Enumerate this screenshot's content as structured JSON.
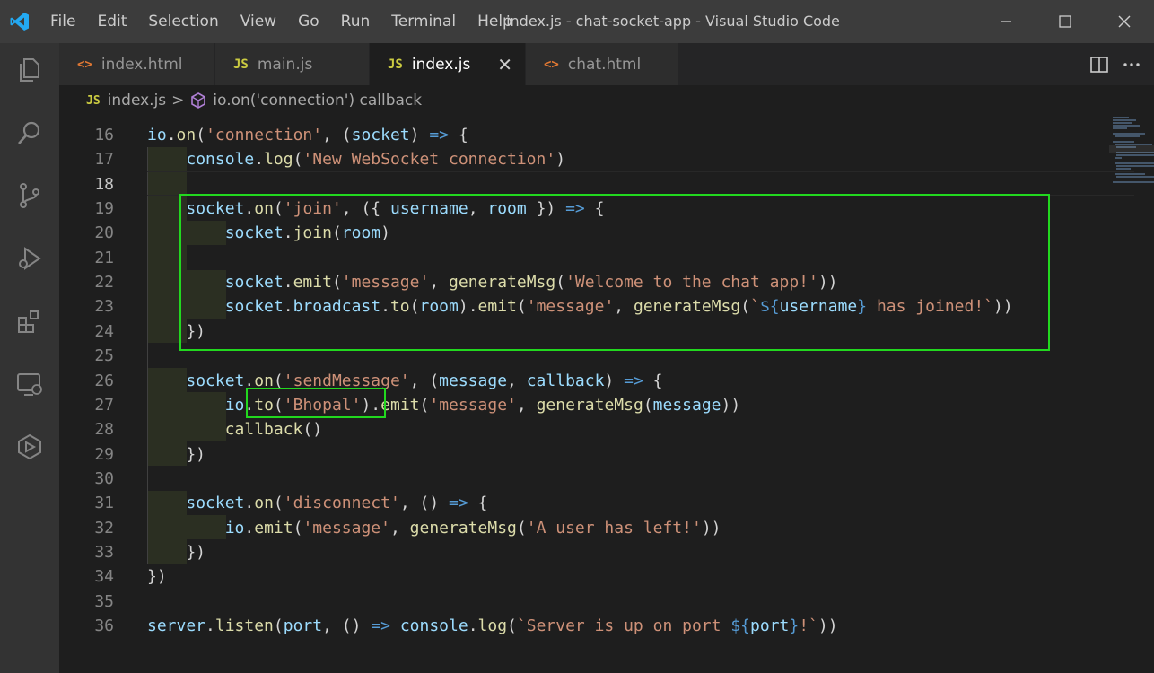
{
  "menu": [
    "File",
    "Edit",
    "Selection",
    "View",
    "Go",
    "Run",
    "Terminal",
    "Help"
  ],
  "window_title": "index.js - chat-socket-app - Visual Studio Code",
  "tabs": [
    {
      "label": "index.html",
      "icon": "<>",
      "type": "html",
      "active": false
    },
    {
      "label": "main.js",
      "icon": "JS",
      "type": "js",
      "active": false
    },
    {
      "label": "index.js",
      "icon": "JS",
      "type": "js",
      "active": true
    },
    {
      "label": "chat.html",
      "icon": "<>",
      "type": "html",
      "active": false
    }
  ],
  "tab_close": "✕",
  "breadcrumb": {
    "file_icon": "JS",
    "file": "index.js",
    "separator": ">",
    "symbol": "io.on('connection') callback"
  },
  "line_numbers": [
    "16",
    "17",
    "18",
    "19",
    "20",
    "21",
    "22",
    "23",
    "24",
    "25",
    "26",
    "27",
    "28",
    "29",
    "30",
    "31",
    "32",
    "33",
    "34",
    "35",
    "36"
  ],
  "current_line": "18",
  "code_lines": [
    [
      [
        "var",
        "io"
      ],
      [
        "pun",
        "."
      ],
      [
        "fn",
        "on"
      ],
      [
        "pun",
        "("
      ],
      [
        "str",
        "'connection'"
      ],
      [
        "pun",
        ", ("
      ],
      [
        "var",
        "socket"
      ],
      [
        "pun",
        ") "
      ],
      [
        "kw",
        "=>"
      ],
      [
        "pun",
        " {"
      ]
    ],
    [
      [
        "pun",
        "    "
      ],
      [
        "var",
        "console"
      ],
      [
        "pun",
        "."
      ],
      [
        "fn",
        "log"
      ],
      [
        "pun",
        "("
      ],
      [
        "str",
        "'New WebSocket connection'"
      ],
      [
        "pun",
        ")"
      ]
    ],
    [],
    [
      [
        "pun",
        "    "
      ],
      [
        "var",
        "socket"
      ],
      [
        "pun",
        "."
      ],
      [
        "fn",
        "on"
      ],
      [
        "pun",
        "("
      ],
      [
        "str",
        "'join'"
      ],
      [
        "pun",
        ", ({ "
      ],
      [
        "var",
        "username"
      ],
      [
        "pun",
        ", "
      ],
      [
        "var",
        "room"
      ],
      [
        "pun",
        " }) "
      ],
      [
        "kw",
        "=>"
      ],
      [
        "pun",
        " {"
      ]
    ],
    [
      [
        "pun",
        "        "
      ],
      [
        "var",
        "socket"
      ],
      [
        "pun",
        "."
      ],
      [
        "fn",
        "join"
      ],
      [
        "pun",
        "("
      ],
      [
        "var",
        "room"
      ],
      [
        "pun",
        ")"
      ]
    ],
    [],
    [
      [
        "pun",
        "        "
      ],
      [
        "var",
        "socket"
      ],
      [
        "pun",
        "."
      ],
      [
        "fn",
        "emit"
      ],
      [
        "pun",
        "("
      ],
      [
        "str",
        "'message'"
      ],
      [
        "pun",
        ", "
      ],
      [
        "fn",
        "generateMsg"
      ],
      [
        "pun",
        "("
      ],
      [
        "str",
        "'Welcome to the chat app!'"
      ],
      [
        "pun",
        "))"
      ]
    ],
    [
      [
        "pun",
        "        "
      ],
      [
        "var",
        "socket"
      ],
      [
        "pun",
        "."
      ],
      [
        "var",
        "broadcast"
      ],
      [
        "pun",
        "."
      ],
      [
        "fn",
        "to"
      ],
      [
        "pun",
        "("
      ],
      [
        "var",
        "room"
      ],
      [
        "pun",
        ")."
      ],
      [
        "fn",
        "emit"
      ],
      [
        "pun",
        "("
      ],
      [
        "str",
        "'message'"
      ],
      [
        "pun",
        ", "
      ],
      [
        "fn",
        "generateMsg"
      ],
      [
        "pun",
        "("
      ],
      [
        "str",
        "`"
      ],
      [
        "kw",
        "${"
      ],
      [
        "var",
        "username"
      ],
      [
        "kw",
        "}"
      ],
      [
        "str",
        " has joined!`"
      ],
      [
        "pun",
        "))"
      ]
    ],
    [
      [
        "pun",
        "    })"
      ]
    ],
    [],
    [
      [
        "pun",
        "    "
      ],
      [
        "var",
        "socket"
      ],
      [
        "pun",
        "."
      ],
      [
        "fn",
        "on"
      ],
      [
        "pun",
        "("
      ],
      [
        "str",
        "'sendMessage'"
      ],
      [
        "pun",
        ", ("
      ],
      [
        "var",
        "message"
      ],
      [
        "pun",
        ", "
      ],
      [
        "var",
        "callback"
      ],
      [
        "pun",
        ") "
      ],
      [
        "kw",
        "=>"
      ],
      [
        "pun",
        " {"
      ]
    ],
    [
      [
        "pun",
        "        "
      ],
      [
        "var",
        "io"
      ],
      [
        "pun",
        "."
      ],
      [
        "fn",
        "to"
      ],
      [
        "pun",
        "("
      ],
      [
        "str",
        "'Bhopal'"
      ],
      [
        "pun",
        ")."
      ],
      [
        "fn",
        "emit"
      ],
      [
        "pun",
        "("
      ],
      [
        "str",
        "'message'"
      ],
      [
        "pun",
        ", "
      ],
      [
        "fn",
        "generateMsg"
      ],
      [
        "pun",
        "("
      ],
      [
        "var",
        "message"
      ],
      [
        "pun",
        "))"
      ]
    ],
    [
      [
        "pun",
        "        "
      ],
      [
        "fn",
        "callback"
      ],
      [
        "pun",
        "()"
      ]
    ],
    [
      [
        "pun",
        "    })"
      ]
    ],
    [],
    [
      [
        "pun",
        "    "
      ],
      [
        "var",
        "socket"
      ],
      [
        "pun",
        "."
      ],
      [
        "fn",
        "on"
      ],
      [
        "pun",
        "("
      ],
      [
        "str",
        "'disconnect'"
      ],
      [
        "pun",
        ", () "
      ],
      [
        "kw",
        "=>"
      ],
      [
        "pun",
        " {"
      ]
    ],
    [
      [
        "pun",
        "        "
      ],
      [
        "var",
        "io"
      ],
      [
        "pun",
        "."
      ],
      [
        "fn",
        "emit"
      ],
      [
        "pun",
        "("
      ],
      [
        "str",
        "'message'"
      ],
      [
        "pun",
        ", "
      ],
      [
        "fn",
        "generateMsg"
      ],
      [
        "pun",
        "("
      ],
      [
        "str",
        "'A user has left!'"
      ],
      [
        "pun",
        "))"
      ]
    ],
    [
      [
        "pun",
        "    })"
      ]
    ],
    [
      [
        "pun",
        "})"
      ]
    ],
    [],
    [
      [
        "var",
        "server"
      ],
      [
        "pun",
        "."
      ],
      [
        "fn",
        "listen"
      ],
      [
        "pun",
        "("
      ],
      [
        "var",
        "port"
      ],
      [
        "pun",
        ", () "
      ],
      [
        "kw",
        "=>"
      ],
      [
        "pun",
        " "
      ],
      [
        "var",
        "console"
      ],
      [
        "pun",
        "."
      ],
      [
        "fn",
        "log"
      ],
      [
        "pun",
        "("
      ],
      [
        "str",
        "`Server is up on port "
      ],
      [
        "kw",
        "${"
      ],
      [
        "var",
        "port"
      ],
      [
        "kw",
        "}"
      ],
      [
        "str",
        "!`"
      ],
      [
        "pun",
        "))"
      ]
    ]
  ],
  "colors": {
    "keyword": "#569cd6",
    "variable": "#9cdcfe",
    "function": "#dcdcaa",
    "string": "#ce9178",
    "highlight_box": "#22d81f",
    "activity_bar": "#333333",
    "title_bar": "#3c3c3c"
  },
  "activity_icons": [
    "explorer-icon",
    "search-icon",
    "source-control-icon",
    "run-debug-icon",
    "extensions-icon",
    "remote-explorer-icon",
    "live-share-icon"
  ]
}
